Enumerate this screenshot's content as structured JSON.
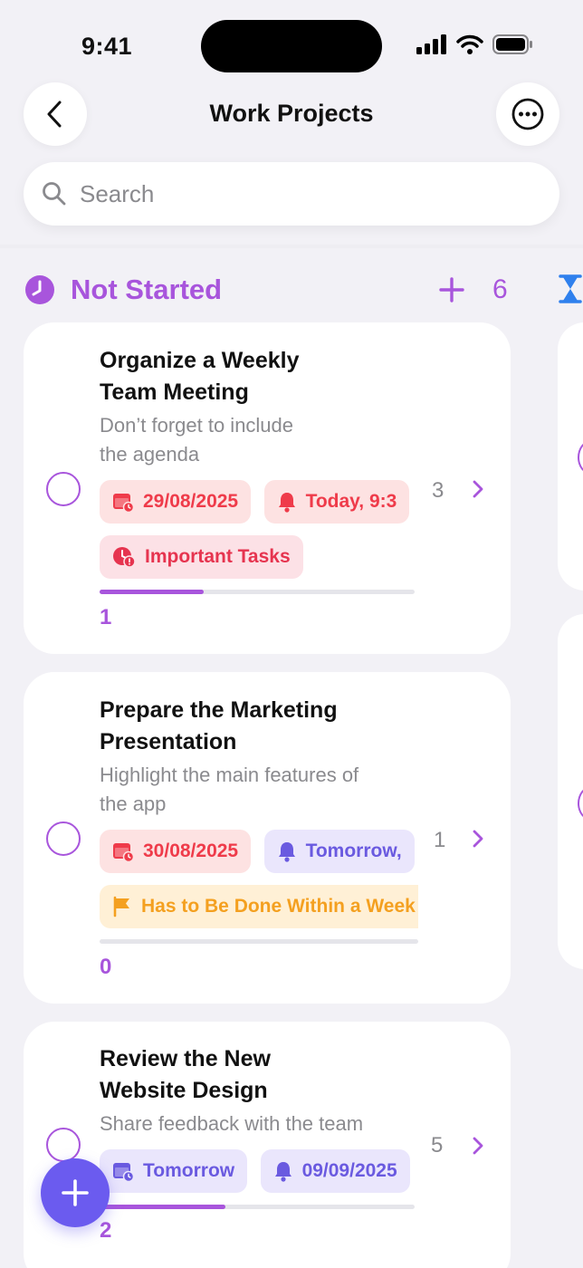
{
  "status_bar": {
    "time": "9:41"
  },
  "header": {
    "title": "Work Projects"
  },
  "search": {
    "placeholder": "Search"
  },
  "column": {
    "title": "Not Started",
    "count": "6"
  },
  "colors": {
    "accent": "#A855DC",
    "fab": "#6B5BEF",
    "tag_red": "#EF3B4A",
    "tag_purple": "#6A5AE0",
    "tag_orange": "#F4A020"
  },
  "cards": [
    {
      "title_line1": "Organize a Weekly",
      "title_line2": "Team Meeting",
      "desc_line1": "Don’t forget to include",
      "desc_line2": "the agenda",
      "subtask_count": "3",
      "progress_fraction": 0.33,
      "progress_label": "1",
      "tags_row1": [
        {
          "label": "29/08/2025",
          "icon": "calendar-clock-icon",
          "style": "red"
        },
        {
          "label": "Today, 9:3",
          "icon": "bell-icon",
          "style": "red"
        }
      ],
      "tags_row2": [
        {
          "label": "Important Tasks",
          "icon": "alert-clock-icon",
          "style": "pink"
        }
      ]
    },
    {
      "title_line1": "Prepare the Marketing",
      "title_line2": "Presentation",
      "desc_line1": "Highlight the main features of",
      "desc_line2": "the app",
      "subtask_count": "1",
      "progress_fraction": 0,
      "progress_label": "0",
      "tags_row1": [
        {
          "label": "30/08/2025",
          "icon": "calendar-clock-icon",
          "style": "red"
        },
        {
          "label": "Tomorrow,",
          "icon": "bell-icon",
          "style": "purple"
        }
      ],
      "tags_row2": [
        {
          "label": "Has to Be Done Within a Week",
          "icon": "flag-icon",
          "style": "orange"
        }
      ]
    },
    {
      "title_line1": "Review the New",
      "title_line2": "Website Design",
      "desc_line1": "Share feedback with the team",
      "subtask_count": "5",
      "progress_fraction": 0.4,
      "progress_label": "2",
      "tags_row1": [
        {
          "label": "Tomorrow",
          "icon": "calendar-clock-icon",
          "style": "purple"
        },
        {
          "label": "09/09/2025",
          "icon": "bell-icon",
          "style": "purple"
        }
      ]
    }
  ]
}
